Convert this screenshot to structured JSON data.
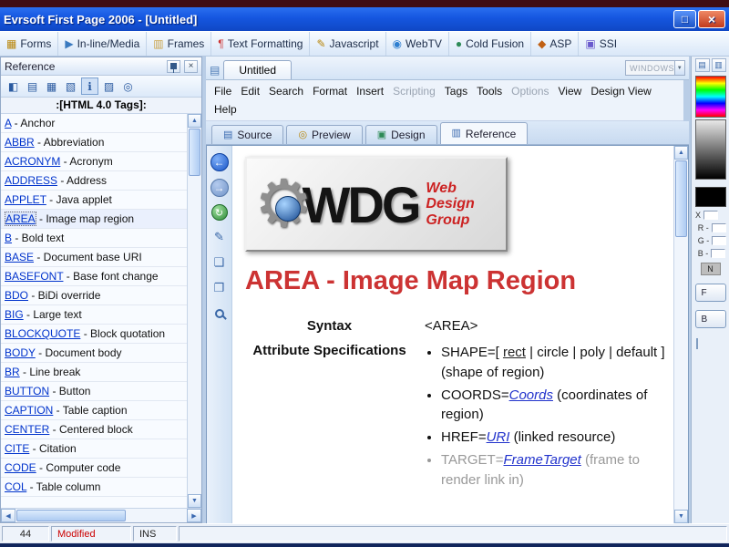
{
  "window": {
    "title": "Evrsoft First Page 2006 - [Untitled]",
    "buttons": [
      {
        "name": "maximize-button",
        "glyph": "□",
        "style": "max"
      },
      {
        "name": "close-button",
        "glyph": "×",
        "style": "close"
      }
    ]
  },
  "toolbar": {
    "items": [
      {
        "label": "Forms",
        "glyph": "▦",
        "color": "#b8860b"
      },
      {
        "label": "In-line/Media",
        "glyph": "▶",
        "color": "#3a7abf"
      },
      {
        "label": "Frames",
        "glyph": "▥",
        "color": "#caa34a"
      },
      {
        "label": "Text Formatting",
        "glyph": "¶",
        "color": "#cc3333"
      },
      {
        "label": "Javascript",
        "glyph": "✎",
        "color": "#b8860b"
      },
      {
        "label": "WebTV",
        "glyph": "◉",
        "color": "#2e7fd0"
      },
      {
        "label": "Cold Fusion",
        "glyph": "●",
        "color": "#2e8b57"
      },
      {
        "label": "ASP",
        "glyph": "◆",
        "color": "#c06014"
      },
      {
        "label": "SSI",
        "glyph": "▣",
        "color": "#6a5acd"
      }
    ]
  },
  "reference_panel": {
    "title": "Reference",
    "header": ":[HTML 4.0 Tags]:",
    "icons": [
      {
        "name": "nav-left-icon",
        "glyph": "◧"
      },
      {
        "name": "contents-icon",
        "glyph": "▤"
      },
      {
        "name": "open-folder-icon",
        "glyph": "▦"
      },
      {
        "name": "folder-icon",
        "glyph": "▧"
      },
      {
        "name": "info-icon",
        "glyph": "ℹ",
        "active": true
      },
      {
        "name": "index-icon",
        "glyph": "▨"
      },
      {
        "name": "search-icon",
        "glyph": "◎"
      }
    ],
    "tags": [
      {
        "tag": "A",
        "desc": " - Anchor"
      },
      {
        "tag": "ABBR",
        "desc": " - Abbreviation"
      },
      {
        "tag": "ACRONYM",
        "desc": " - Acronym"
      },
      {
        "tag": "ADDRESS",
        "desc": " - Address"
      },
      {
        "tag": "APPLET",
        "desc": " - Java applet"
      },
      {
        "tag": "AREA",
        "desc": " - Image map region",
        "selected": true
      },
      {
        "tag": "B",
        "desc": " - Bold text"
      },
      {
        "tag": "BASE",
        "desc": " - Document base URI"
      },
      {
        "tag": "BASEFONT",
        "desc": " - Base font change"
      },
      {
        "tag": "BDO",
        "desc": " - BiDi override"
      },
      {
        "tag": "BIG",
        "desc": " - Large text"
      },
      {
        "tag": "BLOCKQUOTE",
        "desc": " - Block quotation"
      },
      {
        "tag": "BODY",
        "desc": " - Document body"
      },
      {
        "tag": "BR",
        "desc": " - Line break"
      },
      {
        "tag": "BUTTON",
        "desc": " - Button"
      },
      {
        "tag": "CAPTION",
        "desc": " - Table caption"
      },
      {
        "tag": "CENTER",
        "desc": " - Centered block"
      },
      {
        "tag": "CITE",
        "desc": " - Citation"
      },
      {
        "tag": "CODE",
        "desc": " - Computer code"
      },
      {
        "tag": "COL",
        "desc": " - Table column"
      }
    ]
  },
  "editor": {
    "tab": "Untitled",
    "windows_dropdown": "WINDOWS",
    "menus": [
      {
        "label": "File"
      },
      {
        "label": "Edit"
      },
      {
        "label": "Search"
      },
      {
        "label": "Format"
      },
      {
        "label": "Insert"
      },
      {
        "label": "Scripting",
        "disabled": true
      },
      {
        "label": "Tags"
      },
      {
        "label": "Tools"
      },
      {
        "label": "Options",
        "disabled": true
      },
      {
        "label": "View"
      },
      {
        "label": "Design View"
      },
      {
        "label": "Help"
      }
    ],
    "view_tabs": [
      {
        "label": "Source",
        "glyph": "▤",
        "color": "#3a6ab0"
      },
      {
        "label": "Preview",
        "glyph": "◎",
        "color": "#b8860b"
      },
      {
        "label": "Design",
        "glyph": "▣",
        "color": "#2e8b57"
      },
      {
        "label": "Reference",
        "glyph": "▥",
        "color": "#3a6ab0",
        "active": true
      }
    ],
    "side_icons": [
      {
        "name": "back-icon",
        "glyph": "←",
        "style": "back"
      },
      {
        "name": "forward-icon",
        "glyph": "→",
        "style": "fwd"
      },
      {
        "name": "refresh-icon",
        "glyph": "↻",
        "style": "green"
      },
      {
        "name": "edit-icon",
        "glyph": "✎",
        "style": "flat"
      },
      {
        "name": "copy-icon",
        "glyph": "❏",
        "style": "flat"
      },
      {
        "name": "duplicate-icon",
        "glyph": "❐",
        "style": "flat"
      },
      {
        "name": "zoom-icon",
        "glyph": "",
        "style": "zoom"
      }
    ]
  },
  "page": {
    "logo": {
      "wdg": "WDG",
      "line1": "Web",
      "line2": "Design",
      "line3": "Group"
    },
    "heading": "AREA - Image Map Region",
    "syntax_label": "Syntax",
    "syntax_value": "<AREA>",
    "attr_label": "Attribute Specifications",
    "bullets": [
      {
        "pre": "SHAPE=[ ",
        "link": "rect",
        "post": " | circle | poly | default ] (shape of region)"
      },
      {
        "pre": "COORDS=",
        "link": "Coords",
        "post": " (coordinates of region)",
        "italic": true
      },
      {
        "pre": "HREF=",
        "link": "URI",
        "post": " (linked resource)",
        "italic": true
      },
      {
        "pre": "TARGET=",
        "link": "FrameTarget",
        "post": " (frame to render link in)",
        "italic": true,
        "gray": true
      }
    ]
  },
  "color_panel": {
    "buttons": [
      {
        "name": "palette-icon",
        "glyph": "▤"
      },
      {
        "name": "picker-icon",
        "glyph": "▥"
      }
    ],
    "x_label": "X",
    "rgb_labels": [
      "R -",
      "G -",
      "B -"
    ],
    "n_label": "N",
    "f_button": "F",
    "b_button": "B"
  },
  "statusbar": {
    "line": "44",
    "modified": "Modified",
    "mode": "INS"
  }
}
